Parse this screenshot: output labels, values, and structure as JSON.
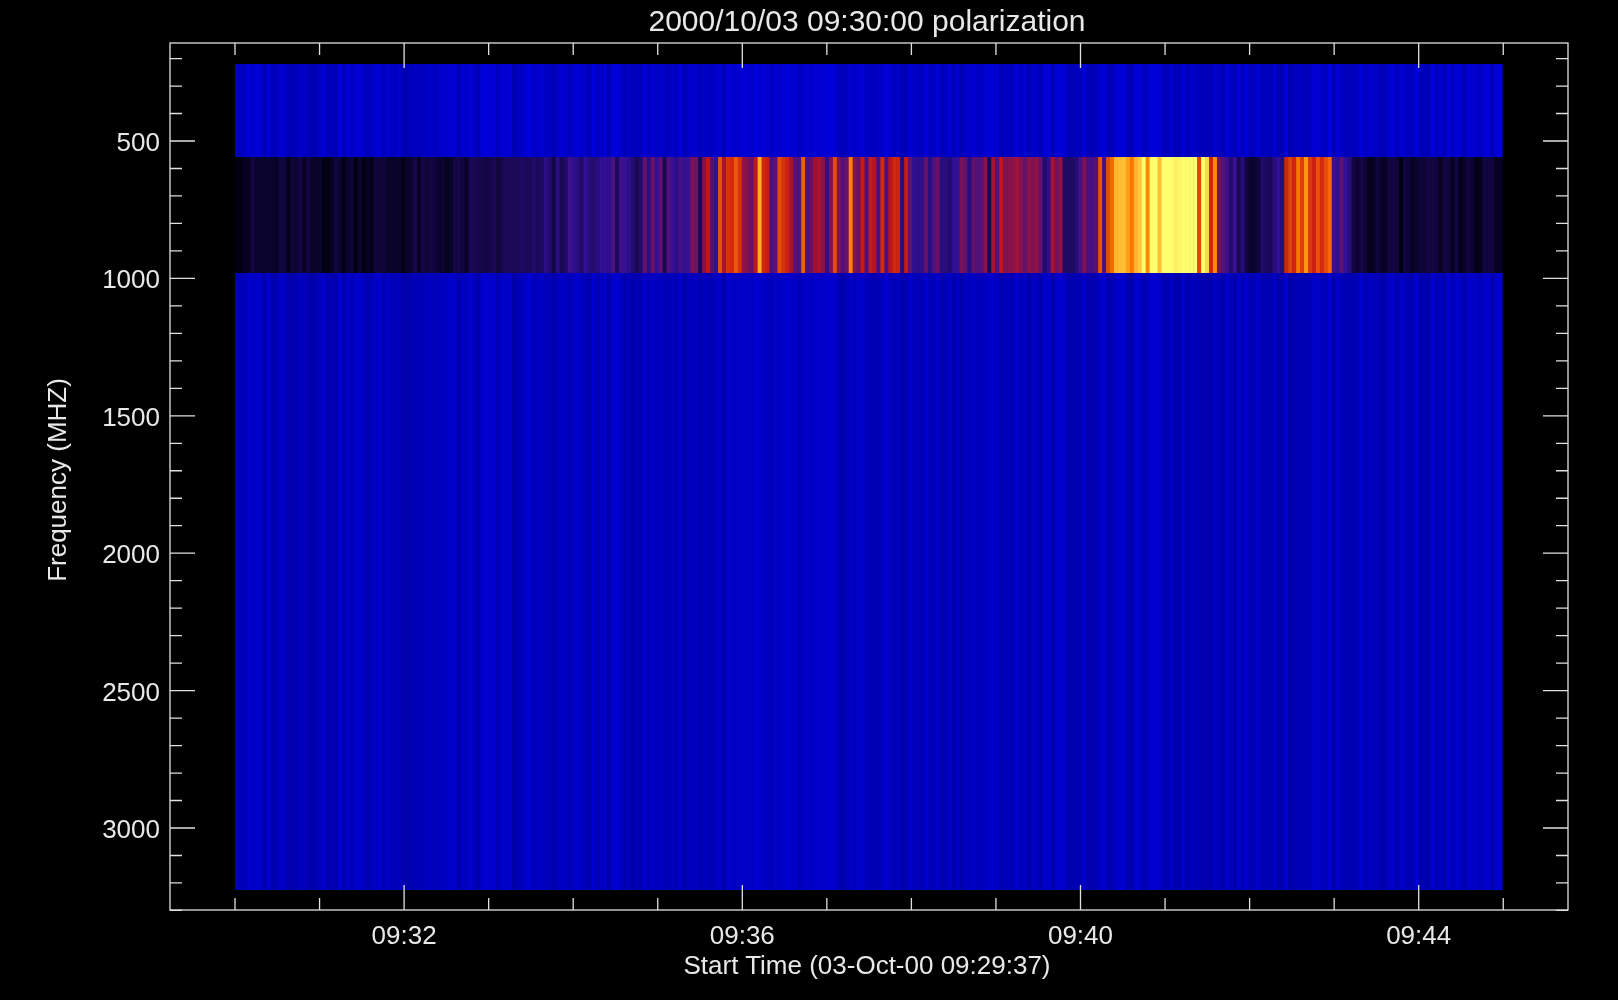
{
  "title": "2000/10/03 09:30:00 polarization",
  "ylabel": "Frequency (MHZ)",
  "xlabel": "Start Time (03-Oct-00 09:29:37)",
  "yticks": [
    "500",
    "1000",
    "1500",
    "2000",
    "2500",
    "3000"
  ],
  "xticks": [
    "09:32",
    "09:36",
    "09:40",
    "09:44"
  ]
}
